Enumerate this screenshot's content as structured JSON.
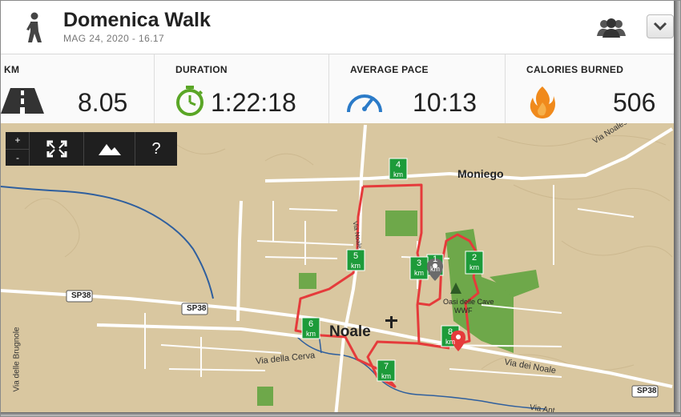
{
  "activity": {
    "title": "Domenica Walk",
    "date": "MAG 24, 2020  -  16.17",
    "icon": "walking-person-icon"
  },
  "header": {
    "friends_icon": "friends-icon",
    "dropdown_icon": "chevron-down-icon"
  },
  "stats": [
    {
      "label": "KM",
      "value": "8.05",
      "icon": "road-icon"
    },
    {
      "label": "DURATION",
      "value": "1:22:18",
      "icon": "stopwatch-icon"
    },
    {
      "label": "AVERAGE PACE",
      "value": "10:13",
      "icon": "speedometer-icon"
    },
    {
      "label": "CALORIES BURNED",
      "value": "506",
      "icon": "flame-icon"
    }
  ],
  "map_tools": {
    "zoom_in": "+",
    "zoom_out": "-",
    "fullscreen_icon": "fullscreen-icon",
    "terrain_icon": "terrain-icon",
    "help": "?"
  },
  "map_labels": {
    "town": "Noale",
    "village": "Moniego",
    "road_sp38_a": "SP38",
    "road_sp38_b": "SP38",
    "road_sp38_c": "SP38",
    "via_cerva": "Via della Cerva",
    "via_noale": "Via dei Noale",
    "via_noalese": "Via Noalese Nor",
    "via_brugnole": "Via delle Brugnole",
    "via_ant": "Via Ant",
    "oasi_line1": "Oasi delle Cave",
    "oasi_line2": "WWF",
    "road_small": "Via Noale"
  },
  "km_markers": [
    "1",
    "2",
    "3",
    "4",
    "5",
    "6",
    "7",
    "8"
  ],
  "km_unit": "km",
  "colors": {
    "route": "#e53b3b",
    "marker": "#1d9b3a",
    "map_bg": "#d9c7a0",
    "park": "#6ea84a",
    "water": "#2f5f9e",
    "accent_green": "#5aa626",
    "accent_blue": "#2b7bc8",
    "accent_orange": "#f08a1c"
  }
}
